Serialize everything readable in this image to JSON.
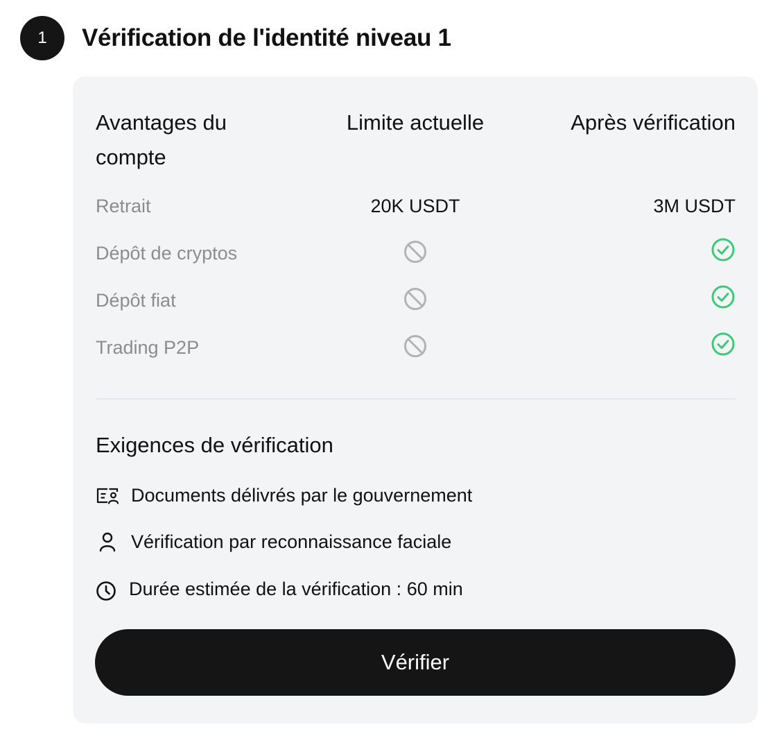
{
  "step": {
    "number": "1",
    "title": "Vérification de l'identité niveau 1"
  },
  "table": {
    "headers": {
      "benefits": "Avantages du compte",
      "current": "Limite actuelle",
      "after": "Après vérification"
    },
    "rows": [
      {
        "label": "Retrait",
        "current": "20K USDT",
        "after": "3M USDT"
      },
      {
        "label": "Dépôt de cryptos",
        "current_icon": "prohibited-icon",
        "after_icon": "check-circle-icon"
      },
      {
        "label": "Dépôt fiat",
        "current_icon": "prohibited-icon",
        "after_icon": "check-circle-icon"
      },
      {
        "label": "Trading P2P",
        "current_icon": "prohibited-icon",
        "after_icon": "check-circle-icon"
      }
    ]
  },
  "requirements": {
    "title": "Exigences de vérification",
    "items": [
      {
        "icon": "id-card-icon",
        "text": "Documents délivrés par le gouvernement"
      },
      {
        "icon": "person-icon",
        "text": "Vérification par reconnaissance faciale"
      },
      {
        "icon": "clock-icon",
        "text": "Durée estimée de la vérification : 60 min"
      }
    ]
  },
  "verify_button": {
    "label": "Vérifier"
  },
  "colors": {
    "badge_bg": "#151515",
    "card_bg": "#f3f4f6",
    "muted_text": "#8c8c8c",
    "prohibited": "#b3b3b3",
    "check": "#3ec87a",
    "button_bg": "#151515"
  }
}
